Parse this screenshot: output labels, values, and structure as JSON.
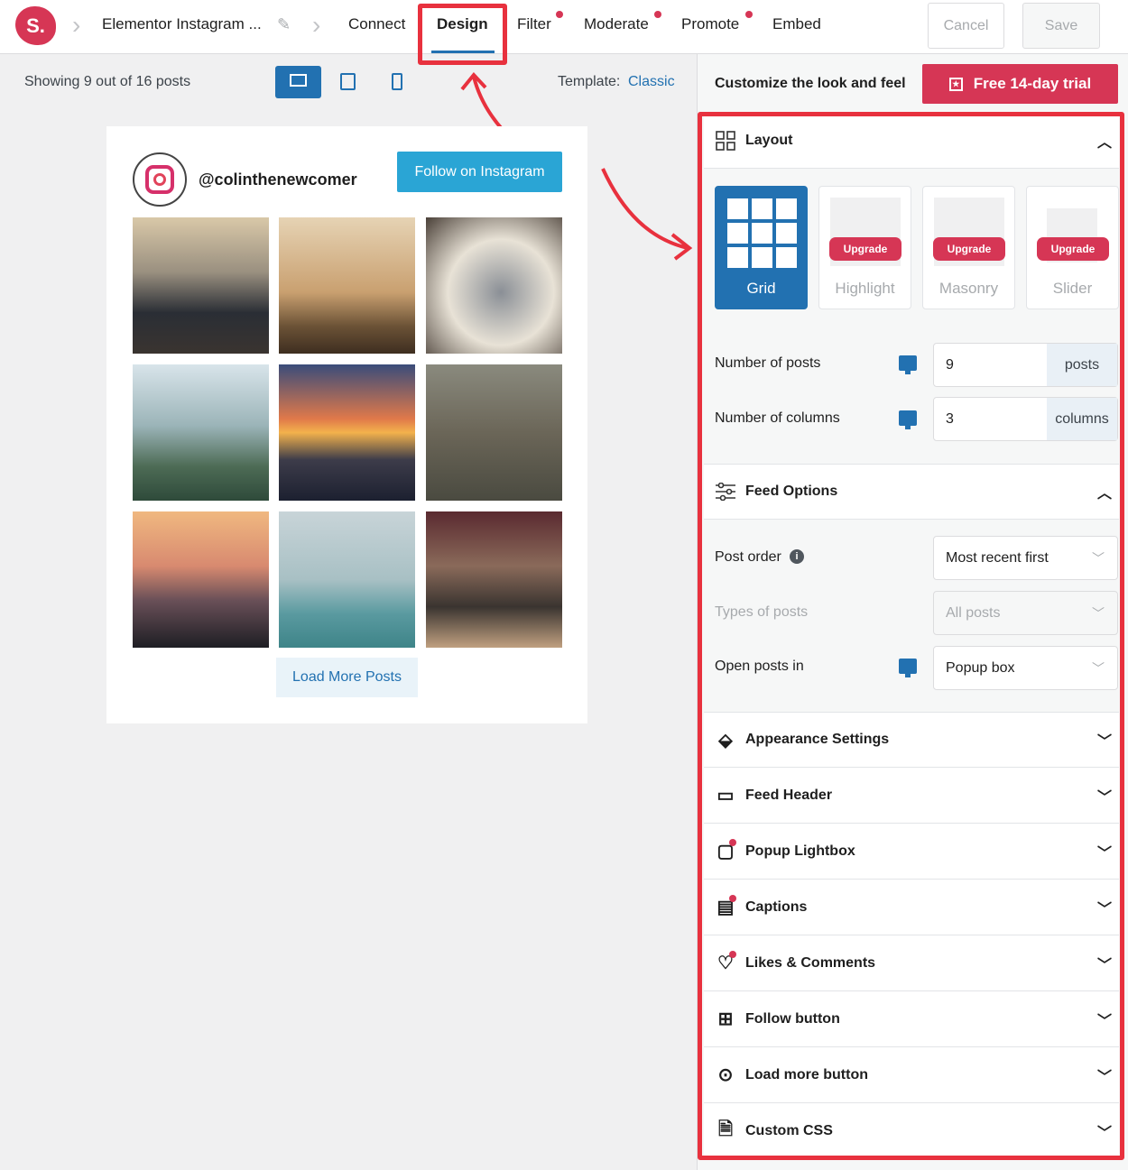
{
  "topbar": {
    "logo": "S.",
    "feed_name": "Elementor Instagram ...",
    "tabs": [
      {
        "label": "Connect"
      },
      {
        "label": "Design",
        "active": true
      },
      {
        "label": "Filter",
        "dot": true
      },
      {
        "label": "Moderate",
        "dot": true
      },
      {
        "label": "Promote",
        "dot": true
      },
      {
        "label": "Embed"
      }
    ],
    "cancel": "Cancel",
    "save": "Save"
  },
  "preview": {
    "showing": "Showing 9 out of 16 posts",
    "template_label": "Template:",
    "template_value": "Classic",
    "username": "@colinthenewcomer",
    "follow": "Follow on Instagram",
    "load_more": "Load More Posts"
  },
  "panel": {
    "title": "Customize the look and feel",
    "trial": "Free 14-day trial",
    "layout": {
      "title": "Layout",
      "options": [
        {
          "label": "Grid",
          "selected": true
        },
        {
          "label": "Highlight",
          "badge": "Upgrade"
        },
        {
          "label": "Masonry",
          "badge": "Upgrade"
        },
        {
          "label": "Slider",
          "badge": "Upgrade"
        }
      ],
      "num_posts_label": "Number of posts",
      "num_posts": "9",
      "num_posts_unit": "posts",
      "num_cols_label": "Number of columns",
      "num_cols": "3",
      "num_cols_unit": "columns"
    },
    "feed_options": {
      "title": "Feed Options",
      "post_order_label": "Post order",
      "post_order": "Most recent first",
      "types_label": "Types of posts",
      "types": "All posts",
      "open_label": "Open posts in",
      "open": "Popup box"
    },
    "sections": [
      {
        "title": "Appearance Settings",
        "icon": "paint-bucket-icon"
      },
      {
        "title": "Feed Header",
        "icon": "header-icon"
      },
      {
        "title": "Popup Lightbox",
        "icon": "lightbox-icon",
        "dot": true
      },
      {
        "title": "Captions",
        "icon": "captions-icon",
        "dot": true
      },
      {
        "title": "Likes & Comments",
        "icon": "heart-icon",
        "dot": true
      },
      {
        "title": "Follow button",
        "icon": "plus-square-icon"
      },
      {
        "title": "Load more button",
        "icon": "ellipsis-circle-icon"
      },
      {
        "title": "Custom CSS",
        "icon": "css-file-icon"
      }
    ]
  },
  "colors": {
    "accent": "#d63655",
    "primary": "#2271b1",
    "highlight": "#e8313e"
  }
}
